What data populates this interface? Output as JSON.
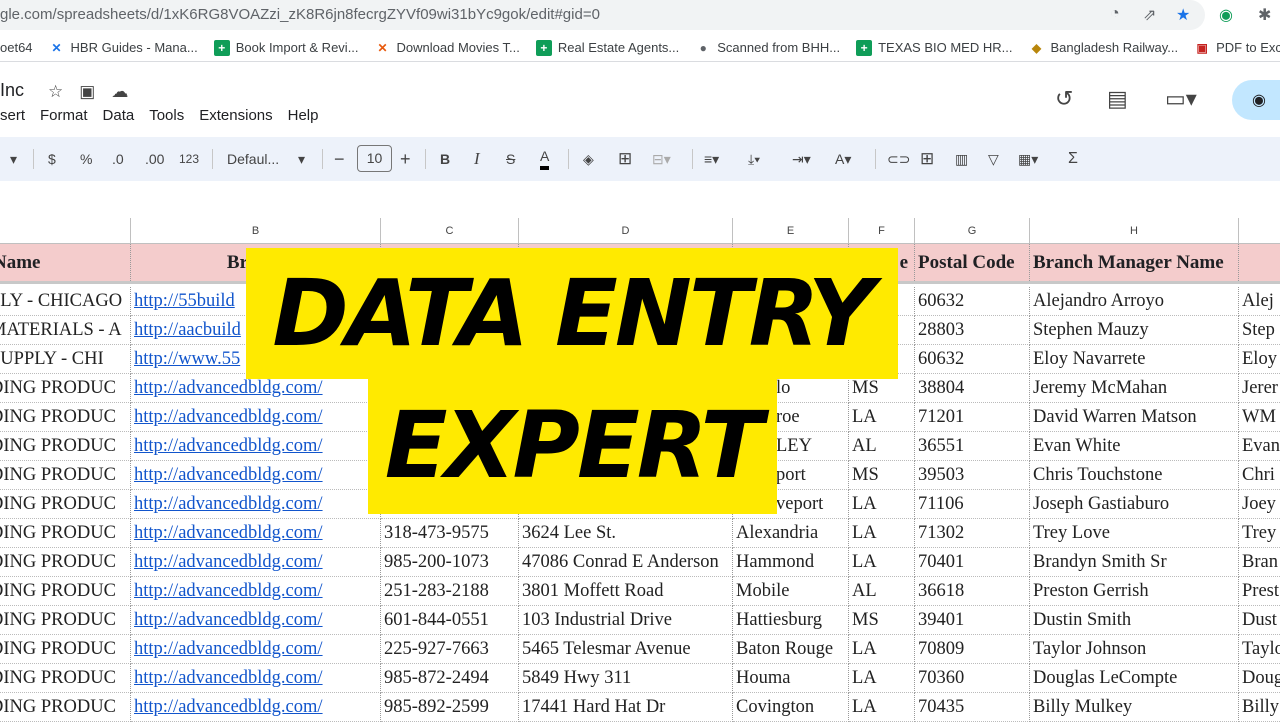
{
  "browser": {
    "url": "gle.com/spreadsheets/d/1xK6RG8VOAZzi_zK8R6jn8fecrgZYVf09wi31bYc9gok/edit#gid=0",
    "bookmarks": [
      {
        "label": "oet64",
        "icon": "none",
        "color": "#fff"
      },
      {
        "label": "HBR Guides - Mana...",
        "icon": "x-icon",
        "color": "#1a73e8"
      },
      {
        "label": "Book Import & Revi...",
        "icon": "sheets-icon",
        "color": "#0f9d58"
      },
      {
        "label": "Download Movies T...",
        "icon": "x-icon",
        "color": "#e8590c"
      },
      {
        "label": "Real Estate Agents...",
        "icon": "sheets-icon",
        "color": "#0f9d58"
      },
      {
        "label": "Scanned from BHH...",
        "icon": "globe-icon",
        "color": "#5f6368"
      },
      {
        "label": "TEXAS BIO MED HR...",
        "icon": "sheets-icon",
        "color": "#0f9d58"
      },
      {
        "label": "Bangladesh Railway...",
        "icon": "railway-icon",
        "color": "#b8860b"
      },
      {
        "label": "PDF to Excel C",
        "icon": "pdf-icon",
        "color": "#c5221f"
      }
    ]
  },
  "doc": {
    "title": "Inc",
    "menu": [
      "sert",
      "Format",
      "Data",
      "Tools",
      "Extensions",
      "Help"
    ]
  },
  "toolbar": {
    "currency": "$",
    "percent": "%",
    "dec_dec": ".0",
    "inc_dec": ".00",
    "number_format": "123",
    "font": "Defaul...",
    "font_size": "10",
    "minus": "−",
    "plus": "+",
    "bold": "B",
    "italic": "I",
    "sum": "Σ"
  },
  "columns": [
    "",
    "B",
    "C",
    "D",
    "E",
    "F",
    "G",
    "H",
    ""
  ],
  "header": [
    "Name",
    "Branch",
    "",
    "",
    "",
    "e",
    "Postal Code",
    "Branch Manager Name",
    ""
  ],
  "rows": [
    [
      "PLY - CHICAGO",
      "http://55build",
      "",
      "",
      "",
      "",
      "60632",
      "Alejandro Arroyo",
      "Alej"
    ],
    [
      "MATERIALS - A",
      "http://aacbuild",
      "",
      "",
      "",
      "",
      "28803",
      "Stephen Mauzy",
      "Step"
    ],
    [
      " SUPPLY - CHI",
      "http://www.55",
      "",
      "",
      "",
      "",
      "60632",
      "Eloy Navarrete",
      "Eloy"
    ],
    [
      "DING PRODUC",
      "http://advancedbldg.com/",
      "",
      "",
      "lo",
      "MS",
      "38804",
      "Jeremy McMahan",
      "Jerer"
    ],
    [
      "DING PRODUC",
      "http://advancedbldg.com/",
      "",
      "",
      "roe",
      "LA",
      "71201",
      "David Warren Matson",
      "WM"
    ],
    [
      "DING PRODUC",
      "http://advancedbldg.com/",
      "",
      "",
      "LEY",
      "AL",
      "36551",
      "Evan White",
      "Evan"
    ],
    [
      "DING PRODUC",
      "http://advancedbldg.com/",
      "",
      "",
      "port",
      "MS",
      "39503",
      "Chris Touchstone",
      "Chri"
    ],
    [
      "DING PRODUC",
      "http://advancedbldg.com/",
      "",
      "",
      "veport",
      "LA",
      "71106",
      "Joseph Gastiaburo",
      "Joey"
    ],
    [
      "DING PRODUC",
      "http://advancedbldg.com/",
      "318-473-9575",
      "3624 Lee St.",
      "Alexandria",
      "LA",
      "71302",
      "Trey Love",
      "Trey"
    ],
    [
      "DING PRODUC",
      "http://advancedbldg.com/",
      "985-200-1073",
      "47086 Conrad E Anderson",
      "Hammond",
      "LA",
      "70401",
      "Brandyn Smith Sr",
      "Bran"
    ],
    [
      "DING PRODUC",
      "http://advancedbldg.com/",
      "251-283-2188",
      "3801 Moffett Road",
      "Mobile",
      "AL",
      "36618",
      "Preston Gerrish",
      "Prest"
    ],
    [
      "DING PRODUC",
      "http://advancedbldg.com/",
      "601-844-0551",
      "103 Industrial Drive",
      "Hattiesburg",
      "MS",
      "39401",
      "Dustin Smith",
      "Dust"
    ],
    [
      "DING PRODUC",
      "http://advancedbldg.com/",
      "225-927-7663",
      "5465 Telesmar Avenue",
      "Baton Rouge",
      "LA",
      "70809",
      "Taylor Johnson",
      "Taylo"
    ],
    [
      "DING PRODUC",
      "http://advancedbldg.com/",
      "985-872-2494",
      "5849 Hwy 311",
      "Houma",
      "LA",
      "70360",
      "Douglas LeCompte",
      "Doug"
    ],
    [
      "DING PRODUC",
      "http://advancedbldg.com/",
      "985-892-2599",
      "17441 Hard Hat Dr",
      "Covington",
      "LA",
      "70435",
      "Billy Mulkey",
      "Billy"
    ]
  ],
  "banner": {
    "line1": "DATA ENTRY",
    "line2": "EXPERT",
    "color": "#ffea00"
  }
}
